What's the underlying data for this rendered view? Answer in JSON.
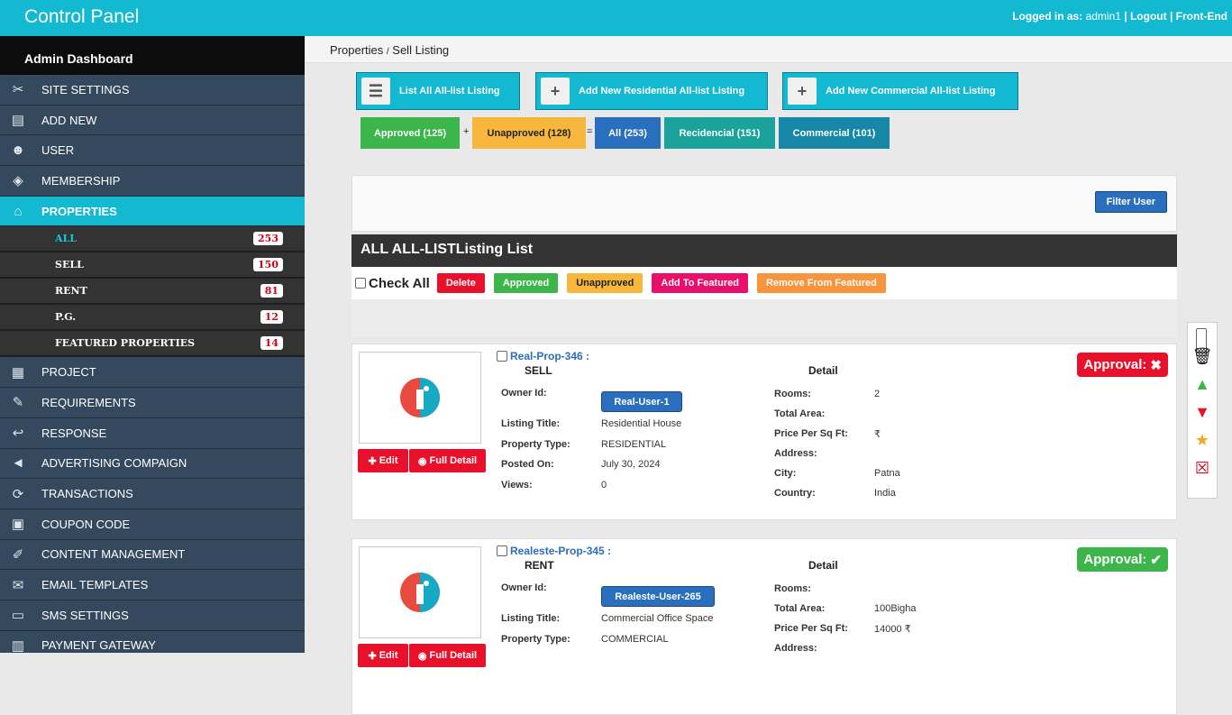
{
  "topbar": {
    "title": "Control Panel",
    "logged_label": "Logged in as:",
    "user": "admin1",
    "sep1": "|",
    "logout": "Logout",
    "sep2": "|",
    "frontend": "Front-End"
  },
  "sidebar": {
    "header": "Admin Dashboard",
    "items": [
      {
        "label": "SITE SETTINGS",
        "icon": "tools-icon"
      },
      {
        "label": "ADD NEW",
        "icon": "add-file-icon"
      },
      {
        "label": "USER",
        "icon": "user-icon"
      },
      {
        "label": "MEMBERSHIP",
        "icon": "ticket-icon"
      },
      {
        "label": "PROPERTIES",
        "icon": "home-icon"
      }
    ],
    "sub_items": [
      {
        "label": "ALL",
        "count": "253"
      },
      {
        "label": "SELL",
        "count": "150"
      },
      {
        "label": "RENT",
        "count": "81"
      },
      {
        "label": "P.G.",
        "count": "12"
      },
      {
        "label": "FEATURED PROPERTIES",
        "count": "14"
      }
    ],
    "items2": [
      {
        "label": "PROJECT",
        "icon": "building-icon"
      },
      {
        "label": "REQUIREMENTS",
        "icon": "edit-doc-icon"
      },
      {
        "label": "RESPONSE",
        "icon": "reply-icon"
      },
      {
        "label": "ADVERTISING COMPAIGN",
        "icon": "megaphone-icon"
      },
      {
        "label": "TRANSACTIONS",
        "icon": "exchange-icon"
      },
      {
        "label": "COUPON CODE",
        "icon": "coupon-icon"
      },
      {
        "label": "CONTENT MANAGEMENT",
        "icon": "content-icon"
      },
      {
        "label": "EMAIL TEMPLATES",
        "icon": "email-icon"
      },
      {
        "label": "SMS SETTINGS",
        "icon": "sms-icon"
      },
      {
        "label": "PAYMENT GATEWAY",
        "icon": "payment-icon"
      }
    ]
  },
  "breadcrumb": {
    "parent": "Properties",
    "sep": "/",
    "current": "Sell Listing"
  },
  "actions": {
    "list_all": "List All All-list Listing",
    "add_residential": "Add New Residential All-list Listing",
    "add_commercial": "Add New Commercial All-list Listing"
  },
  "stats": {
    "approved": "Approved (125)",
    "plus": "+",
    "unapproved": "Unapproved (128)",
    "equals": "=",
    "all": "All (253)",
    "residential": "Recidencial (151)",
    "commercial": "Commercial (101)"
  },
  "filter": {
    "button": "Filter User"
  },
  "list": {
    "title": "ALL ALL-LISTListing List",
    "check_all": "Check All",
    "delete": "Delete",
    "approved": "Approved",
    "unapproved": "Unapproved",
    "add_featured": "Add To Featured",
    "remove_featured": "Remove From Featured"
  },
  "colors": {
    "primary": "#13b9d0",
    "sidebar": "#34495e",
    "green": "#3cb54a",
    "orange": "#f6b73c",
    "red": "#e8102b",
    "blue": "#2a6fbd"
  },
  "labels": {
    "edit": "Edit",
    "full_detail": "Full Detail",
    "detail": "Detail",
    "owner_id": "Owner Id:",
    "listing_title": "Listing Title:",
    "property_type": "Property Type:",
    "posted_on": "Posted On:",
    "views": "Views:",
    "rooms": "Rooms:",
    "total_area": "Total Area:",
    "price_sqft": "Price Per Sq Ft:",
    "address": "Address:",
    "city": "City:",
    "country": "Country:",
    "approval": "Approval:"
  },
  "cards": [
    {
      "id": "Real-Prop-346 :",
      "type": "SELL",
      "owner": "Real-User-1",
      "title": "Residential House",
      "ptype": "RESIDENTIAL",
      "posted": "July 30, 2024",
      "views": "0",
      "rooms": "2",
      "area": "",
      "price": "₹",
      "address": "",
      "city": "Patna",
      "country": "India",
      "approval_state": "unapproved"
    },
    {
      "id": "Realeste-Prop-345 :",
      "type": "RENT",
      "owner": "Realeste-User-265",
      "title": "Commercial Office Space",
      "ptype": "COMMERCIAL",
      "posted": "",
      "views": "",
      "rooms": "",
      "area": "100Bigha",
      "price": "14000 ₹",
      "address": "",
      "city": "",
      "country": "",
      "approval_state": "approved"
    }
  ],
  "side_tools": [
    "checkbox",
    "trash-icon",
    "thumbs-up-icon",
    "thumbs-down-icon",
    "star-icon",
    "unfeature-icon"
  ]
}
